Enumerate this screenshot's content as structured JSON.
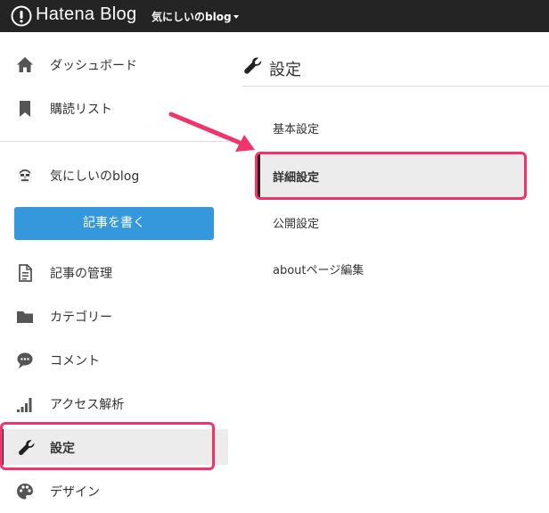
{
  "header": {
    "brand": "Hatena Blog",
    "blog_name": "気にしいのblog"
  },
  "sidebar": {
    "items": [
      {
        "label": "ダッシュボード",
        "icon": "home-icon"
      },
      {
        "label": "購読リスト",
        "icon": "bookmark-icon"
      },
      {
        "label": "気にしいのblog",
        "icon": "blog-avatar-icon"
      },
      {
        "label": "記事の管理",
        "icon": "document-icon"
      },
      {
        "label": "カテゴリー",
        "icon": "folder-icon"
      },
      {
        "label": "コメント",
        "icon": "comment-icon"
      },
      {
        "label": "アクセス解析",
        "icon": "bar-chart-icon"
      },
      {
        "label": "設定",
        "icon": "wrench-icon"
      },
      {
        "label": "デザイン",
        "icon": "palette-icon"
      }
    ],
    "write_button": "記事を書く",
    "active_item": "設定"
  },
  "main": {
    "title": "設定",
    "title_icon": "wrench-icon",
    "subnav": [
      {
        "label": "基本設定"
      },
      {
        "label": "詳細設定"
      },
      {
        "label": "公開設定"
      },
      {
        "label": "aboutページ編集"
      }
    ],
    "active_subnav": "詳細設定"
  },
  "colors": {
    "topbar": "#242424",
    "button": "#3598dc",
    "highlight": "#f0356d",
    "active_bg": "#ececec"
  }
}
